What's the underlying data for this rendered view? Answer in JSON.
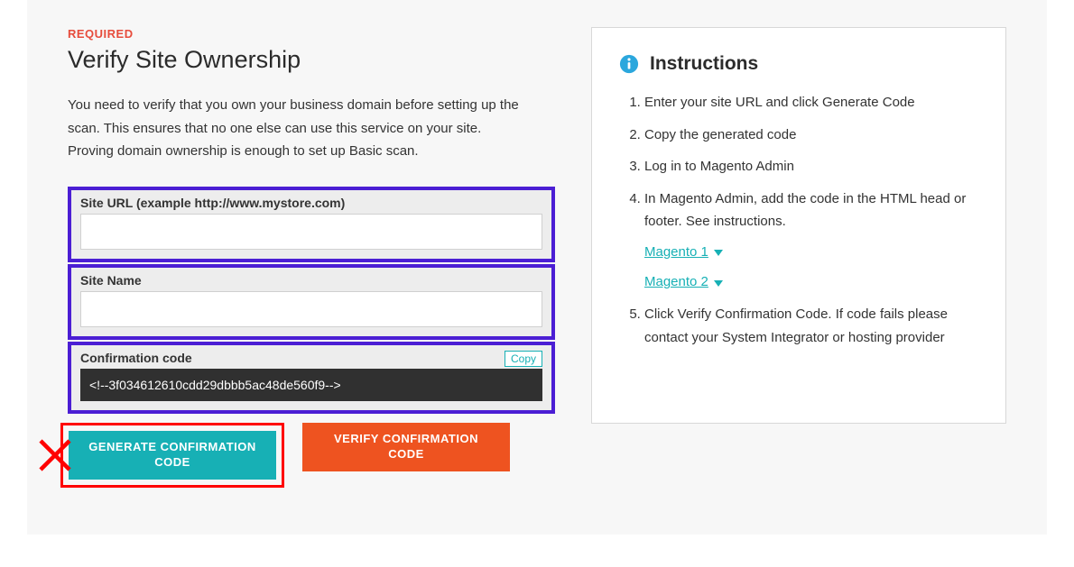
{
  "required_label": "REQUIRED",
  "heading": "Verify Site Ownership",
  "description": "You need to verify that you own your business domain before setting up the scan. This ensures that no one else can use this service on your site. Proving domain ownership is enough to set up Basic scan.",
  "fields": {
    "site_url": {
      "label": "Site URL (example http://www.mystore.com)",
      "value": ""
    },
    "site_name": {
      "label": "Site Name",
      "value": ""
    },
    "confirmation_code": {
      "label": "Confirmation code",
      "copy_label": "Copy",
      "value": "<!--3f034612610cdd29dbbb5ac48de560f9-->"
    }
  },
  "buttons": {
    "generate": "GENERATE CONFIRMATION CODE",
    "verify": "VERIFY CONFIRMATION CODE"
  },
  "instructions": {
    "title": "Instructions",
    "items": [
      "Enter your site URL and click Generate Code",
      "Copy the generated code",
      "Log in to Magento Admin",
      "In Magento Admin, add the code in the HTML head or footer. See instructions.",
      "Click Verify Confirmation Code. If code fails please contact your System Integrator or hosting provider"
    ],
    "links": {
      "magento1": "Magento 1",
      "magento2": "Magento 2"
    }
  },
  "colors": {
    "accent_red": "#e74c3c",
    "accent_teal": "#17b0b5",
    "accent_orange": "#ee5320",
    "highlight_purple": "#4b1ed4",
    "annotation_red": "#ff0000"
  }
}
